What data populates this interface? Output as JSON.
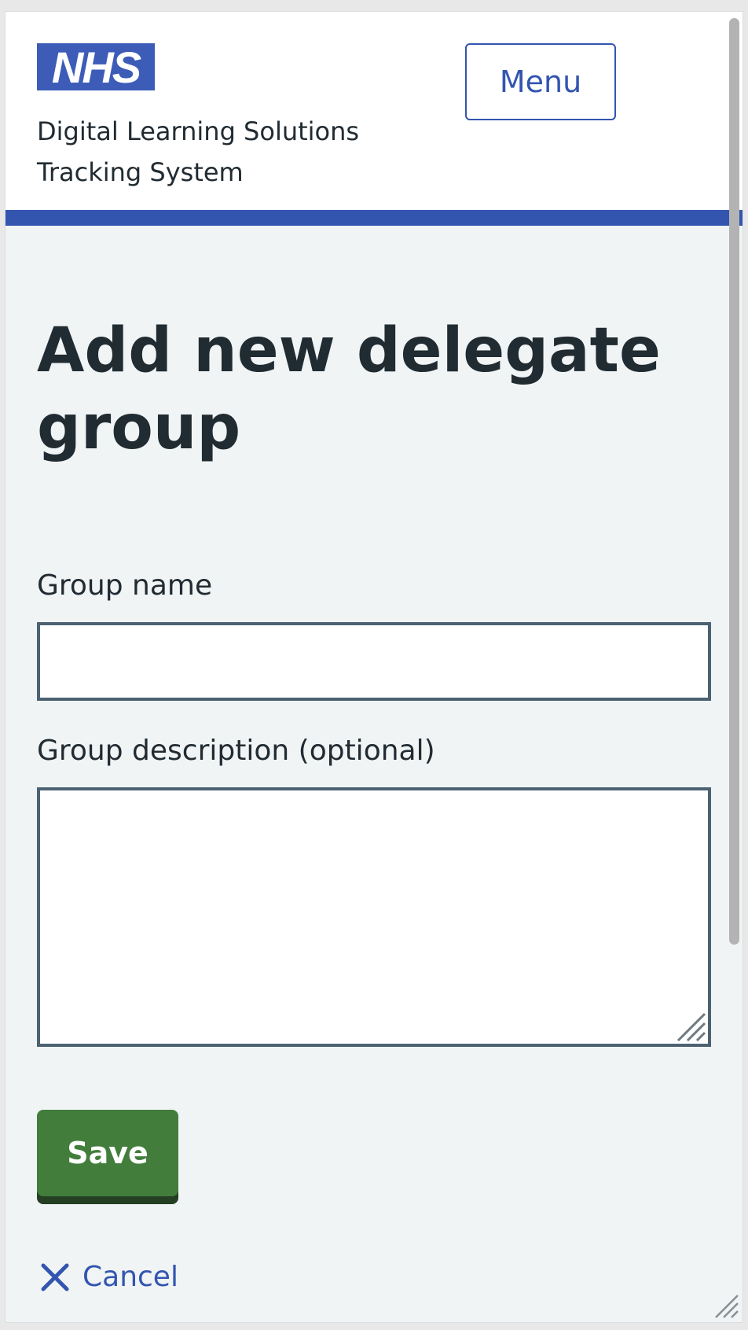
{
  "header": {
    "logo_text": "NHS",
    "service_name_line1": "Digital Learning Solutions",
    "service_name_line2": "Tracking System",
    "menu_label": "Menu"
  },
  "page": {
    "title": "Add new delegate group"
  },
  "form": {
    "group_name_label": "Group name",
    "group_name_value": "",
    "group_description_label": "Group description (optional)",
    "group_description_value": "",
    "save_label": "Save",
    "cancel_label": "Cancel"
  },
  "icons": {
    "cancel": "close-icon",
    "resize": "resize-grip-icon"
  },
  "colors": {
    "nhs_blue": "#3355b0",
    "save_green": "#427d3c",
    "text": "#212b32",
    "background": "#f0f4f5",
    "input_border": "#4c6272"
  }
}
